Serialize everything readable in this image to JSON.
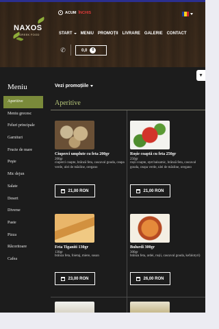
{
  "brand": {
    "name": "NAXOS",
    "tagline": "GREEK FOOD"
  },
  "status": {
    "prefix": "ACUM",
    "state": "ÎNCHIS"
  },
  "nav": [
    {
      "label": "START",
      "has_caret": true
    },
    {
      "label": "MENIU",
      "has_caret": false
    },
    {
      "label": "PROMOȚII",
      "has_caret": false
    },
    {
      "label": "LIVRARE",
      "has_caret": false
    },
    {
      "label": "GALERIE",
      "has_caret": false
    },
    {
      "label": "CONTACT",
      "has_caret": false
    }
  ],
  "cart": {
    "amount": "0,0",
    "currency_icon": "lei",
    "count": "0"
  },
  "sidebar": {
    "title": "Meniu",
    "items": [
      "Aperitive",
      "Meniu grecesc",
      "Feluri principale",
      "Garnituri",
      "Fructe de mare",
      "Peşte",
      "Mic dejun",
      "Salate",
      "Desert",
      "Diverse",
      "Paste",
      "Pizza",
      "Răcoritoare",
      "Cafea"
    ],
    "active_index": 0
  },
  "promo_dropdown": "Vezi promoțiile",
  "section": {
    "title": "Aperitive"
  },
  "products": [
    {
      "title": "Ciuperci umplute cu feta 200gr",
      "weight": "200gr",
      "desc": "ciuperci coapte, brânză feta, cascaval gouda, ceapa verde, ulei de măsline, oregano",
      "price": "21,00 RON"
    },
    {
      "title": "Roșie coaptă cu feta 250gr",
      "weight": "250gr",
      "desc": "roșii coapte, oțet balsamic, brânză feta, cascaval gouda, ceapa verde, ulei de măsline, oregano",
      "price": "21,00 RON"
    },
    {
      "title": "Feta Tiganiti 130gr",
      "weight": "130gr",
      "desc": "brânza feta, foietaj, miere, susan",
      "price": "23,00 RON"
    },
    {
      "title": "Bulurdi 300gr",
      "weight": "300gr",
      "desc": "brânza feta, ardei, roșii, cascaval gouda, kefalotyri)",
      "price": "26,00 RON"
    }
  ],
  "colors": {
    "topbar": "#2b2f8f",
    "accent_green": "#7a8a3a",
    "section_title": "#b7c77a",
    "closed_red": "#e03a3a",
    "page_bg": "#1c1c1c"
  }
}
